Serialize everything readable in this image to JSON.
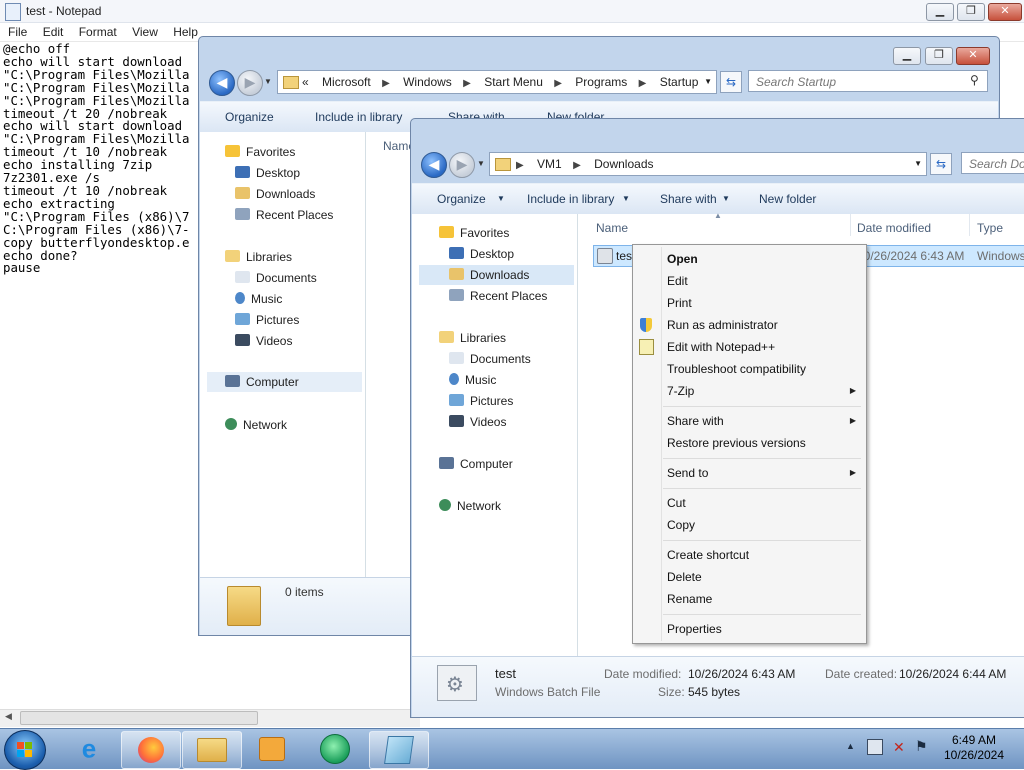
{
  "notepad": {
    "title": "test - Notepad",
    "menu": [
      "File",
      "Edit",
      "Format",
      "View",
      "Help"
    ],
    "lines": [
      "@echo off",
      "echo will start download",
      "\"C:\\Program Files\\Mozilla",
      "\"C:\\Program Files\\Mozilla",
      "\"C:\\Program Files\\Mozilla",
      "timeout /t 20 /nobreak",
      "echo will start download",
      "\"C:\\Program Files\\Mozilla",
      "timeout /t 10 /nobreak",
      "echo installing 7zip",
      "7z2301.exe /s",
      "timeout /t 10 /nobreak",
      "echo extracting",
      "\"C:\\Program Files (x86)\\7",
      "C:\\Program Files (x86)\\7-",
      "copy butterflyondesktop.e",
      "echo done?",
      "pause"
    ]
  },
  "explorer1": {
    "address": [
      "Microsoft",
      "Windows",
      "Start Menu",
      "Programs",
      "Startup"
    ],
    "address_prefix": "«",
    "search_placeholder": "Search Startup",
    "toolbar": [
      "Organize",
      "Include in library",
      "Share with",
      "New folder"
    ],
    "column_name": "Name",
    "nav": {
      "favorites": "Favorites",
      "favorites_items": [
        "Desktop",
        "Downloads",
        "Recent Places"
      ],
      "libraries": "Libraries",
      "libraries_items": [
        "Documents",
        "Music",
        "Pictures",
        "Videos"
      ],
      "computer": "Computer",
      "network": "Network"
    },
    "status": "0 items"
  },
  "explorer2": {
    "address": [
      "VM1",
      "Downloads"
    ],
    "search_placeholder": "Search Do",
    "toolbar": [
      "Organize",
      "Include in library",
      "Share with",
      "New folder"
    ],
    "columns": [
      "Name",
      "Date modified",
      "Type"
    ],
    "nav": {
      "favorites": "Favorites",
      "favorites_items": [
        "Desktop",
        "Downloads",
        "Recent Places"
      ],
      "libraries": "Libraries",
      "libraries_items": [
        "Documents",
        "Music",
        "Pictures",
        "Videos"
      ],
      "computer": "Computer",
      "network": "Network"
    },
    "file": {
      "name": "tes",
      "date": "10/26/2024 6:43 AM",
      "type": "Windows"
    },
    "details": {
      "name": "test",
      "type": "Windows Batch File",
      "modified_label": "Date modified:",
      "modified_value": "10/26/2024 6:43 AM",
      "created_label": "Date created:",
      "created_value": "10/26/2024 6:44 AM",
      "size_label": "Size:",
      "size_value": "545 bytes"
    }
  },
  "context_menu": {
    "items": [
      "Open",
      "Edit",
      "Print",
      "Run as administrator",
      "Edit with Notepad++",
      "Troubleshoot compatibility",
      "7-Zip",
      "Share with",
      "Restore previous versions",
      "Send to",
      "Cut",
      "Copy",
      "Create shortcut",
      "Delete",
      "Rename",
      "Properties"
    ]
  },
  "clock": {
    "time": "6:49 AM",
    "date": "10/26/2024"
  },
  "colors": {
    "window_frame": "#c2d5ec",
    "toolbar_text": "#1e395b",
    "taskbar_top": "#a9c4e3",
    "taskbar_bottom": "#6f94c2",
    "selection": "#cde8ff"
  }
}
